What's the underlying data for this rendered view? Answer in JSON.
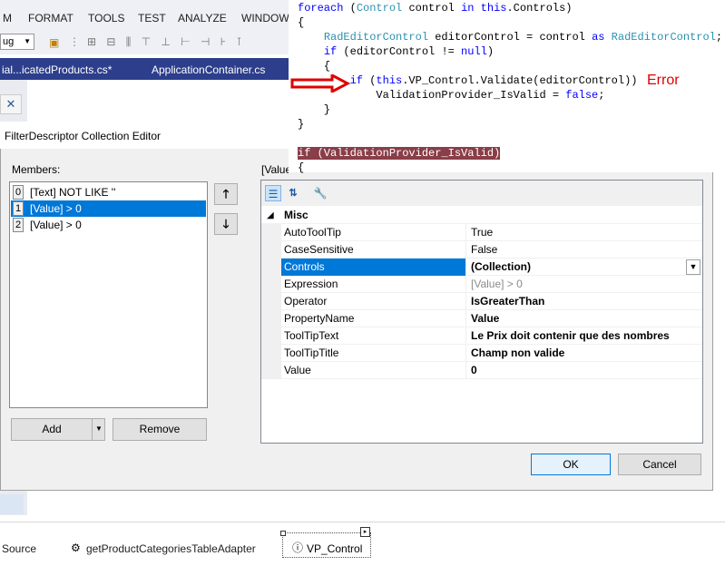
{
  "ide": {
    "menu": [
      "M",
      "FORMAT",
      "TOOLS",
      "TEST",
      "ANALYZE",
      "WINDOW"
    ],
    "config_value": "ug",
    "tabs": [
      "ial...icatedProducts.cs*",
      "ApplicationContainer.cs"
    ],
    "close_glyph": "✕"
  },
  "code": {
    "lines": [
      "foreach (Control control in this.Controls)",
      "{",
      "    RadEditorControl editorControl = control as RadEditorControl;",
      "    if (editorControl != null)",
      "    {",
      "        if (this.VP_Control.Validate(editorControl))",
      "            ValidationProvider_IsValid = false;",
      "    }",
      "}",
      "",
      "if (ValidationProvider_IsValid)",
      "{"
    ],
    "error_label": "Error",
    "arrow_color": "#e00000"
  },
  "dialog": {
    "title": "FilterDescriptor Collection Editor",
    "members_label": "Members:",
    "members": [
      {
        "index": "0",
        "text": "[Text] NOT LIKE ''"
      },
      {
        "index": "1",
        "text": "[Value] > 0"
      },
      {
        "index": "2",
        "text": "[Value] > 0"
      }
    ],
    "selected_member": 1,
    "properties_label": "[Value",
    "add_label": "Add",
    "remove_label": "Remove",
    "ok_label": "OK",
    "cancel_label": "Cancel"
  },
  "propgrid": {
    "category": "Misc",
    "rows": [
      {
        "name": "AutoToolTip",
        "value": "True",
        "style": "normal"
      },
      {
        "name": "CaseSensitive",
        "value": "False",
        "style": "normal"
      },
      {
        "name": "Controls",
        "value": "(Collection)",
        "style": "bold"
      },
      {
        "name": "Expression",
        "value": "[Value] > 0",
        "style": "gray"
      },
      {
        "name": "Operator",
        "value": "IsGreaterThan",
        "style": "bold"
      },
      {
        "name": "PropertyName",
        "value": "Value",
        "style": "bold"
      },
      {
        "name": "ToolTipText",
        "value": "Le Prix doit contenir que des nombres",
        "style": "bold"
      },
      {
        "name": "ToolTipTitle",
        "value": "Champ non valide",
        "style": "bold"
      },
      {
        "name": "Value",
        "value": "0",
        "style": "bold"
      }
    ],
    "selected_row": 2
  },
  "tray": {
    "items": [
      "Source",
      "getProductCategoriesTableAdapter",
      "VP_Control"
    ]
  }
}
